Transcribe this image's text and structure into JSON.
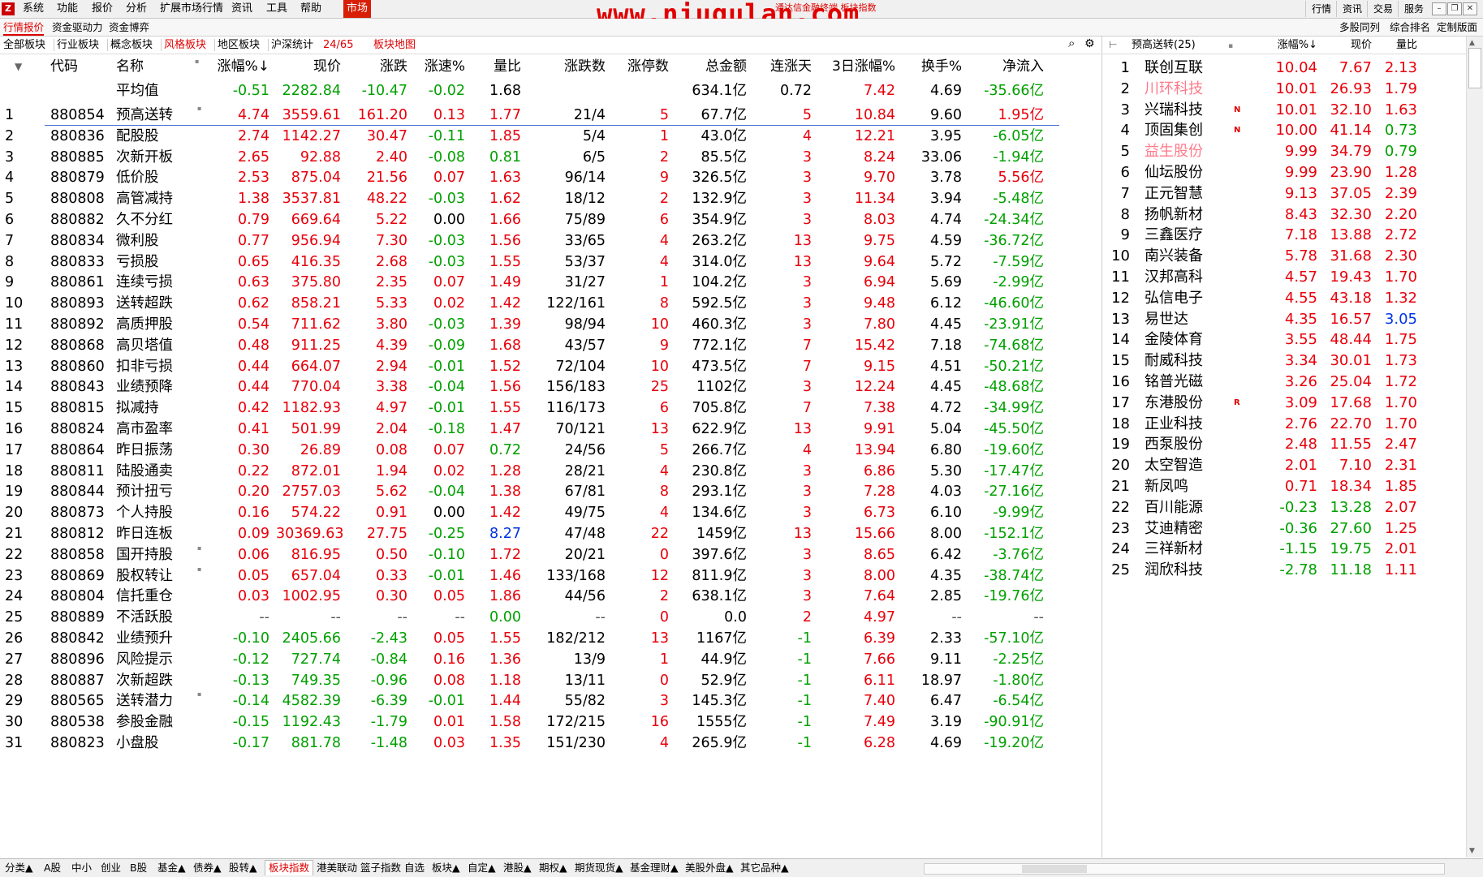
{
  "menubar": {
    "items": [
      "系统",
      "功能",
      "报价",
      "分析",
      "扩展市场行情",
      "资讯",
      "工具",
      "帮助"
    ],
    "market_tab": "市场",
    "watermark": "www.niugulan.com",
    "watermark_sub": "通达信金融终端 板块指数",
    "right_buttons": [
      "行情",
      "资讯",
      "交易",
      "服务"
    ]
  },
  "bar2": {
    "items": [
      "行情报价",
      "资金驱动力",
      "资金博弈"
    ],
    "right_items": [
      "多股同列",
      "综合排名",
      "定制版面"
    ]
  },
  "bar3": {
    "items": [
      "全部板块",
      "行业板块",
      "概念板块",
      "风格板块",
      "地区板块",
      "沪深统计"
    ],
    "page": "24/65",
    "map": "板块地图"
  },
  "table": {
    "headers": [
      "代码",
      "名称",
      "涨幅%↓",
      "现价",
      "涨跌",
      "涨速%",
      "量比",
      "涨跌数",
      "涨停数",
      "总金额",
      "连涨天",
      "3日涨幅%",
      "换手%",
      "净流入"
    ],
    "average": {
      "label": "平均值",
      "pct": "-0.51",
      "price": "2282.84",
      "chg": "-10.47",
      "speed": "-0.02",
      "vr": "1.68",
      "updown": "",
      "limit": "",
      "amount": "634.1亿",
      "days": "0.72",
      "d3": "7.42",
      "turn": "4.69",
      "flow": "-35.66亿"
    },
    "rows": [
      [
        "1",
        "880854",
        "预高送转",
        "4.74",
        "3559.61",
        "161.20",
        "0.13",
        "1.77",
        "21/4",
        "5",
        "67.7亿",
        "5",
        "10.84",
        "9.60",
        "1.95亿"
      ],
      [
        "2",
        "880836",
        "配股股",
        "2.74",
        "1142.27",
        "30.47",
        "-0.11",
        "1.85",
        "5/4",
        "1",
        "43.0亿",
        "4",
        "12.21",
        "3.95",
        "-6.05亿"
      ],
      [
        "3",
        "880885",
        "次新开板",
        "2.65",
        "92.88",
        "2.40",
        "-0.08",
        "0.81",
        "6/5",
        "2",
        "85.5亿",
        "3",
        "8.24",
        "33.06",
        "-1.94亿"
      ],
      [
        "4",
        "880879",
        "低价股",
        "2.53",
        "875.04",
        "21.56",
        "0.07",
        "1.63",
        "96/14",
        "9",
        "326.5亿",
        "3",
        "9.70",
        "3.78",
        "5.56亿"
      ],
      [
        "5",
        "880808",
        "高管减持",
        "1.38",
        "3537.81",
        "48.22",
        "-0.03",
        "1.62",
        "18/12",
        "2",
        "132.9亿",
        "3",
        "11.34",
        "3.94",
        "-5.48亿"
      ],
      [
        "6",
        "880882",
        "久不分红",
        "0.79",
        "669.64",
        "5.22",
        "0.00",
        "1.66",
        "75/89",
        "6",
        "354.9亿",
        "3",
        "8.03",
        "4.74",
        "-24.34亿"
      ],
      [
        "7",
        "880834",
        "微利股",
        "0.77",
        "956.94",
        "7.30",
        "-0.03",
        "1.56",
        "33/65",
        "4",
        "263.2亿",
        "13",
        "9.75",
        "4.59",
        "-36.72亿"
      ],
      [
        "8",
        "880833",
        "亏损股",
        "0.65",
        "416.35",
        "2.68",
        "-0.03",
        "1.55",
        "53/37",
        "4",
        "314.0亿",
        "13",
        "9.64",
        "5.72",
        "-7.59亿"
      ],
      [
        "9",
        "880861",
        "连续亏损",
        "0.63",
        "375.80",
        "2.35",
        "0.07",
        "1.49",
        "31/27",
        "1",
        "104.2亿",
        "3",
        "6.94",
        "5.69",
        "-2.99亿"
      ],
      [
        "10",
        "880893",
        "送转超跌",
        "0.62",
        "858.21",
        "5.33",
        "0.02",
        "1.42",
        "122/161",
        "8",
        "592.5亿",
        "3",
        "9.48",
        "6.12",
        "-46.60亿"
      ],
      [
        "11",
        "880892",
        "高质押股",
        "0.54",
        "711.62",
        "3.80",
        "-0.03",
        "1.39",
        "98/94",
        "10",
        "460.3亿",
        "3",
        "7.80",
        "4.45",
        "-23.91亿"
      ],
      [
        "12",
        "880868",
        "高贝塔值",
        "0.48",
        "911.25",
        "4.39",
        "-0.09",
        "1.68",
        "43/57",
        "9",
        "772.1亿",
        "7",
        "15.42",
        "7.18",
        "-74.68亿"
      ],
      [
        "13",
        "880860",
        "扣非亏损",
        "0.44",
        "664.07",
        "2.94",
        "-0.01",
        "1.52",
        "72/104",
        "10",
        "473.5亿",
        "7",
        "9.15",
        "4.51",
        "-50.21亿"
      ],
      [
        "14",
        "880843",
        "业绩预降",
        "0.44",
        "770.04",
        "3.38",
        "-0.04",
        "1.56",
        "156/183",
        "25",
        "1102亿",
        "3",
        "12.24",
        "4.45",
        "-48.68亿"
      ],
      [
        "15",
        "880815",
        "拟减持",
        "0.42",
        "1182.93",
        "4.97",
        "-0.01",
        "1.55",
        "116/173",
        "6",
        "705.8亿",
        "7",
        "7.38",
        "4.72",
        "-34.99亿"
      ],
      [
        "16",
        "880824",
        "高市盈率",
        "0.41",
        "501.99",
        "2.04",
        "-0.18",
        "1.47",
        "70/121",
        "13",
        "622.9亿",
        "13",
        "9.91",
        "5.04",
        "-45.50亿"
      ],
      [
        "17",
        "880864",
        "昨日振荡",
        "0.30",
        "26.89",
        "0.08",
        "0.07",
        "0.72",
        "24/56",
        "5",
        "266.7亿",
        "4",
        "13.94",
        "6.80",
        "-19.60亿"
      ],
      [
        "18",
        "880811",
        "陆股通卖",
        "0.22",
        "872.01",
        "1.94",
        "0.02",
        "1.28",
        "28/21",
        "4",
        "230.8亿",
        "3",
        "6.86",
        "5.30",
        "-17.47亿"
      ],
      [
        "19",
        "880844",
        "预计扭亏",
        "0.20",
        "2757.03",
        "5.62",
        "-0.04",
        "1.38",
        "67/81",
        "8",
        "293.1亿",
        "3",
        "7.28",
        "4.03",
        "-27.16亿"
      ],
      [
        "20",
        "880873",
        "个人持股",
        "0.16",
        "574.22",
        "0.91",
        "0.00",
        "1.42",
        "49/75",
        "4",
        "134.6亿",
        "3",
        "6.73",
        "6.10",
        "-9.99亿"
      ],
      [
        "21",
        "880812",
        "昨日连板",
        "0.09",
        "30369.63",
        "27.75",
        "-0.25",
        "8.27",
        "47/48",
        "22",
        "1459亿",
        "13",
        "15.66",
        "8.00",
        "-152.1亿"
      ],
      [
        "22",
        "880858",
        "国开持股",
        "0.06",
        "816.95",
        "0.50",
        "-0.10",
        "1.72",
        "20/21",
        "0",
        "397.6亿",
        "3",
        "8.65",
        "6.42",
        "-3.76亿"
      ],
      [
        "23",
        "880869",
        "股权转让",
        "0.05",
        "657.04",
        "0.33",
        "-0.01",
        "1.46",
        "133/168",
        "12",
        "811.9亿",
        "3",
        "8.00",
        "4.35",
        "-38.74亿"
      ],
      [
        "24",
        "880804",
        "信托重仓",
        "0.03",
        "1002.95",
        "0.30",
        "0.05",
        "1.86",
        "44/56",
        "2",
        "638.1亿",
        "3",
        "7.64",
        "2.85",
        "-19.76亿"
      ],
      [
        "25",
        "880889",
        "不活跃股",
        "--",
        "--",
        "--",
        "--",
        "0.00",
        "--",
        "0",
        "0.0",
        "2",
        "4.97",
        "--",
        "--"
      ],
      [
        "26",
        "880842",
        "业绩预升",
        "-0.10",
        "2405.66",
        "-2.43",
        "0.05",
        "1.55",
        "182/212",
        "13",
        "1167亿",
        "-1",
        "6.39",
        "2.33",
        "-57.10亿"
      ],
      [
        "27",
        "880896",
        "风险提示",
        "-0.12",
        "727.74",
        "-0.84",
        "0.16",
        "1.36",
        "13/9",
        "1",
        "44.9亿",
        "-1",
        "7.66",
        "9.11",
        "-2.25亿"
      ],
      [
        "28",
        "880887",
        "次新超跌",
        "-0.13",
        "749.35",
        "-0.96",
        "0.08",
        "1.18",
        "13/11",
        "0",
        "52.9亿",
        "-1",
        "6.11",
        "18.97",
        "-1.80亿"
      ],
      [
        "29",
        "880565",
        "送转潜力",
        "-0.14",
        "4582.39",
        "-6.39",
        "-0.01",
        "1.44",
        "55/82",
        "3",
        "145.3亿",
        "-1",
        "7.40",
        "6.47",
        "-6.54亿"
      ],
      [
        "30",
        "880538",
        "参股金融",
        "-0.15",
        "1192.43",
        "-1.79",
        "0.01",
        "1.58",
        "172/215",
        "16",
        "1555亿",
        "-1",
        "7.49",
        "3.19",
        "-90.91亿"
      ],
      [
        "31",
        "880823",
        "小盘股",
        "-0.17",
        "881.78",
        "-1.48",
        "0.03",
        "1.35",
        "151/230",
        "4",
        "265.9亿",
        "-1",
        "6.28",
        "4.69",
        "-19.20亿"
      ]
    ]
  },
  "right_panel": {
    "title": "预高送转(25)",
    "headers": [
      "涨幅%↓",
      "现价",
      "量比"
    ],
    "rows": [
      [
        "1",
        "联创互联",
        "",
        "10.04",
        "7.67",
        "2.13"
      ],
      [
        "2",
        "川环科技",
        "",
        "10.01",
        "26.93",
        "1.79"
      ],
      [
        "3",
        "兴瑞科技",
        "N",
        "10.01",
        "32.10",
        "1.63"
      ],
      [
        "4",
        "顶固集创",
        "N",
        "10.00",
        "41.14",
        "0.73"
      ],
      [
        "5",
        "益生股份",
        "",
        "9.99",
        "34.79",
        "0.79"
      ],
      [
        "6",
        "仙坛股份",
        "",
        "9.99",
        "23.90",
        "1.28"
      ],
      [
        "7",
        "正元智慧",
        "",
        "9.13",
        "37.05",
        "2.39"
      ],
      [
        "8",
        "扬帆新材",
        "",
        "8.43",
        "32.30",
        "2.20"
      ],
      [
        "9",
        "三鑫医疗",
        "",
        "7.18",
        "13.88",
        "2.72"
      ],
      [
        "10",
        "南兴装备",
        "",
        "5.78",
        "31.68",
        "2.30"
      ],
      [
        "11",
        "汉邦高科",
        "",
        "4.57",
        "19.43",
        "1.70"
      ],
      [
        "12",
        "弘信电子",
        "",
        "4.55",
        "43.18",
        "1.32"
      ],
      [
        "13",
        "易世达",
        "",
        "4.35",
        "16.57",
        "3.05"
      ],
      [
        "14",
        "金陵体育",
        "",
        "3.55",
        "48.44",
        "1.75"
      ],
      [
        "15",
        "耐威科技",
        "",
        "3.34",
        "30.01",
        "1.73"
      ],
      [
        "16",
        "铭普光磁",
        "",
        "3.26",
        "25.04",
        "1.72"
      ],
      [
        "17",
        "东港股份",
        "R",
        "3.09",
        "17.68",
        "1.70"
      ],
      [
        "18",
        "正业科技",
        "",
        "2.76",
        "22.70",
        "1.70"
      ],
      [
        "19",
        "西泵股份",
        "",
        "2.48",
        "11.55",
        "2.47"
      ],
      [
        "20",
        "太空智造",
        "",
        "2.01",
        "7.10",
        "2.31"
      ],
      [
        "21",
        "新凤鸣",
        "",
        "0.71",
        "18.34",
        "1.85"
      ],
      [
        "22",
        "百川能源",
        "",
        "-0.23",
        "13.28",
        "2.07"
      ],
      [
        "23",
        "艾迪精密",
        "",
        "-0.36",
        "27.60",
        "1.25"
      ],
      [
        "24",
        "三祥新材",
        "",
        "-1.15",
        "19.75",
        "2.01"
      ],
      [
        "25",
        "润欣科技",
        "",
        "-2.78",
        "11.18",
        "1.11"
      ]
    ]
  },
  "bottom_tabs": [
    "分类▲",
    "A股",
    "中小",
    "创业",
    "B股",
    "基金▲",
    "债券▲",
    "股转▲",
    "板块指数",
    "港美联动",
    "篮子指数",
    "自选",
    "板块▲",
    "自定▲",
    "港股▲",
    "期权▲",
    "期货现货▲",
    "基金理财▲",
    "美股外盘▲",
    "其它品种▲"
  ],
  "active_tab": "板块指数",
  "colors": {
    "up": "#e8000b",
    "down": "#00a000",
    "highlight": "#0033e6",
    "accent": "#d81e06"
  }
}
